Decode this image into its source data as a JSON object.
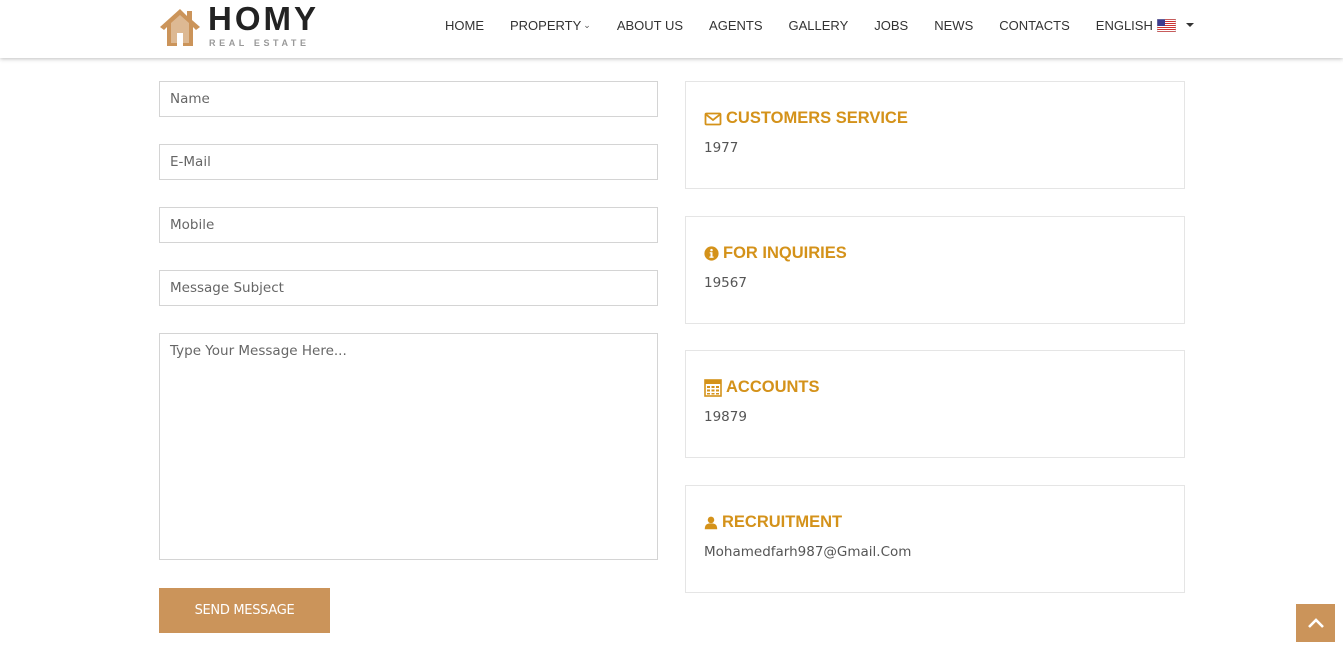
{
  "brand": {
    "name": "HOMY",
    "tagline": "REAL ESTATE",
    "accent_color": "#cb945a",
    "heading_color": "#d4921a"
  },
  "nav": {
    "items": [
      {
        "label": "HOME"
      },
      {
        "label": "PROPERTY",
        "has_dropdown": true
      },
      {
        "label": "ABOUT US"
      },
      {
        "label": "AGENTS"
      },
      {
        "label": "GALLERY"
      },
      {
        "label": "JOBS"
      },
      {
        "label": "NEWS"
      },
      {
        "label": "CONTACTS"
      }
    ],
    "language": {
      "label": "ENGLISH",
      "flag_icon": "us-flag-icon"
    }
  },
  "form": {
    "name_placeholder": "Name",
    "email_placeholder": "E-Mail",
    "mobile_placeholder": "Mobile",
    "subject_placeholder": "Message Subject",
    "message_placeholder": "Type Your Message Here...",
    "submit_label": "SEND MESSAGE"
  },
  "contacts": [
    {
      "icon": "envelope-icon",
      "title": "CUSTOMERS SERVICE",
      "value": "1977"
    },
    {
      "icon": "info-circle-icon",
      "title": "FOR INQUIRIES",
      "value": "19567"
    },
    {
      "icon": "calculator-icon",
      "title": "ACCOUNTS",
      "value": "19879"
    },
    {
      "icon": "user-icon",
      "title": "RECRUITMENT",
      "value": "Mohamedfarh987@Gmail.Com"
    }
  ],
  "scroll_top": {
    "icon": "chevron-up-icon"
  }
}
